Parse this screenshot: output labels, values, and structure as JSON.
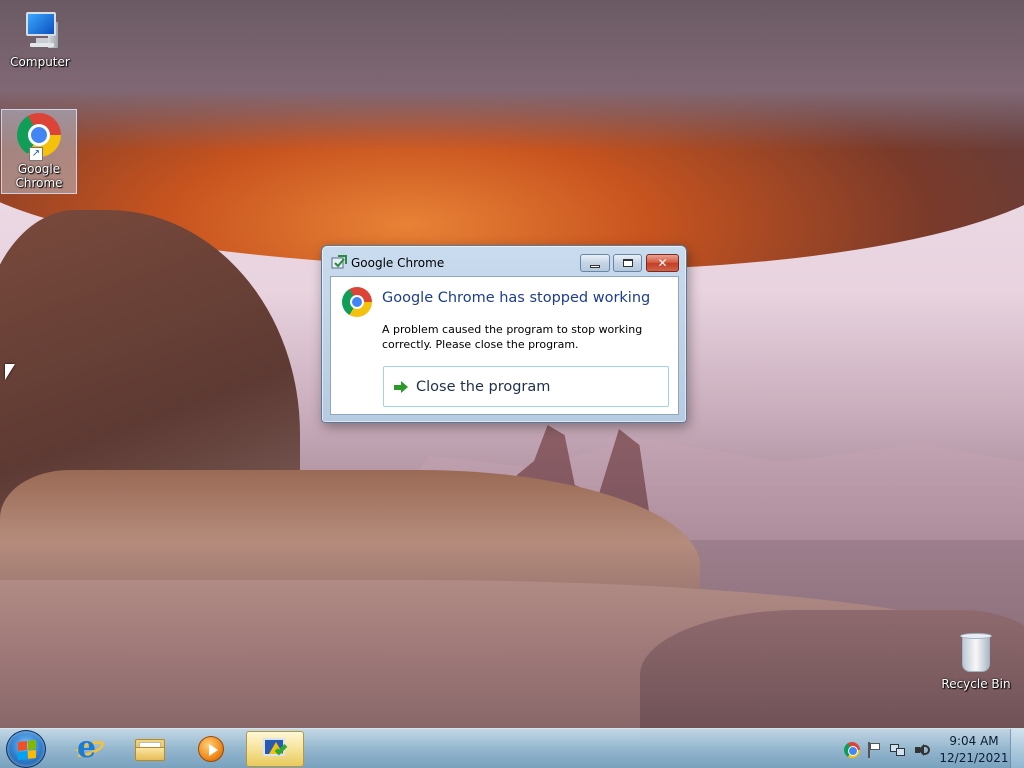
{
  "desktop": {
    "icons": [
      {
        "id": "computer",
        "label": "Computer",
        "icon": "computer-icon",
        "selected": false
      },
      {
        "id": "chrome",
        "label": "Google Chrome",
        "icon": "chrome-icon",
        "selected": true,
        "shortcut": true
      },
      {
        "id": "recycle",
        "label": "Recycle Bin",
        "icon": "recycle-bin-icon",
        "selected": false
      }
    ]
  },
  "dialog": {
    "title": "Google Chrome",
    "title_icon": "error-report-icon",
    "app_icon": "chrome-icon",
    "headline": "Google Chrome has stopped working",
    "message": "A problem caused the program to stop working correctly. Please close the program.",
    "action_label": "Close the program",
    "action_icon": "green-arrow-icon",
    "close_glyph": "✕"
  },
  "taskbar": {
    "start": "start-orb",
    "pinned": [
      {
        "id": "ie",
        "icon": "internet-explorer-icon",
        "active": false
      },
      {
        "id": "explorer",
        "icon": "folder-icon",
        "active": false
      },
      {
        "id": "media",
        "icon": "media-player-icon",
        "active": false
      },
      {
        "id": "task",
        "icon": "error-reporting-task-icon",
        "active": true
      }
    ],
    "tray": {
      "icons": [
        "chrome-tray-icon",
        "action-center-flag-icon",
        "network-icon",
        "volume-icon"
      ],
      "time": "9:04 AM",
      "date": "12/21/2021"
    }
  },
  "colors": {
    "headline": "#1e3d8f",
    "close_button": "#c23d24",
    "active_taskbar_button": "#f6e39a"
  }
}
